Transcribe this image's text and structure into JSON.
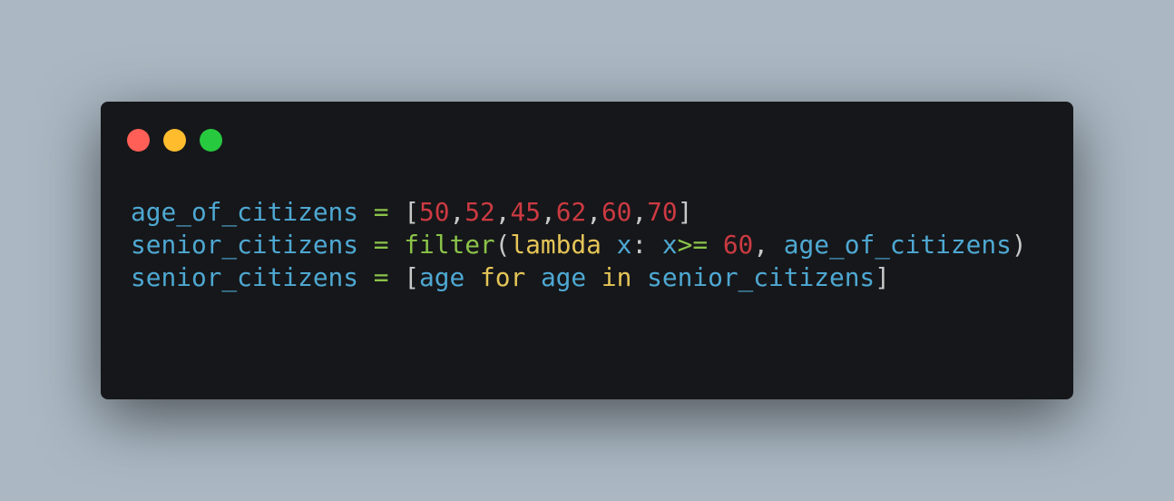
{
  "colors": {
    "background": "#abb8c3",
    "window": "#16171a",
    "close": "#ff5f56",
    "minimize": "#ffbd2e",
    "maximize": "#27c93f",
    "identifier": "#4ea8d2",
    "operator": "#8bc34a",
    "number": "#cc3a42",
    "keyword": "#e5c558",
    "punctuation": "#c8c8c8"
  },
  "window_controls": [
    "close-dot",
    "minimize-dot",
    "maximize-dot"
  ],
  "code": {
    "line1": {
      "var": "age_of_citizens",
      "eq": " = ",
      "open": "[",
      "n1": "50",
      "c1": ",",
      "n2": "52",
      "c2": ",",
      "n3": "45",
      "c3": ",",
      "n4": "62",
      "c4": ",",
      "n5": "60",
      "c5": ",",
      "n6": "70",
      "close": "]"
    },
    "line2": {
      "var": "senior_citizens",
      "eq": " = ",
      "fn": "filter",
      "open": "(",
      "kw": "lambda",
      "sp": " ",
      "param": "x",
      "colon": ": ",
      "param2": "x",
      "op": ">=",
      "sp2": " ",
      "num": "60",
      "comma": ", ",
      "arg": "age_of_citizens",
      "close": ")"
    },
    "line3": {
      "var": "senior_citizens",
      "eq": " = ",
      "open": "[",
      "item": "age",
      "sp1": " ",
      "kw_for": "for",
      "sp2": " ",
      "item2": "age",
      "sp3": " ",
      "kw_in": "in",
      "sp4": " ",
      "src": "senior_citizens",
      "close": "]"
    }
  }
}
